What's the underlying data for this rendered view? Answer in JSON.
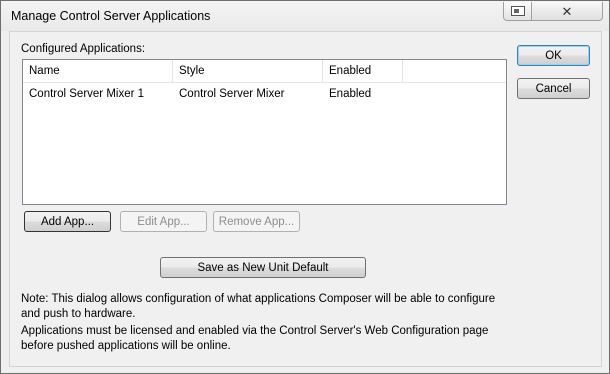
{
  "window": {
    "title": "Manage Control Server Applications",
    "close_symbol": "✕"
  },
  "configured_label": "Configured Applications:",
  "list": {
    "columns": [
      "Name",
      "Style",
      "Enabled"
    ],
    "rows": [
      {
        "name": "Control Server Mixer 1",
        "style": "Control Server Mixer",
        "enabled": "Enabled"
      }
    ]
  },
  "buttons": {
    "ok": "OK",
    "cancel": "Cancel",
    "add_app": "Add App...",
    "edit_app": "Edit App...",
    "remove_app": "Remove App...",
    "save_default": "Save as New Unit Default"
  },
  "notes": {
    "note1": "Note: This dialog allows configuration of what applications Composer will be able to configure and push to hardware.",
    "note2": "Applications must be licensed and enabled via the Control Server's Web Configuration page before pushed applications will be online."
  }
}
